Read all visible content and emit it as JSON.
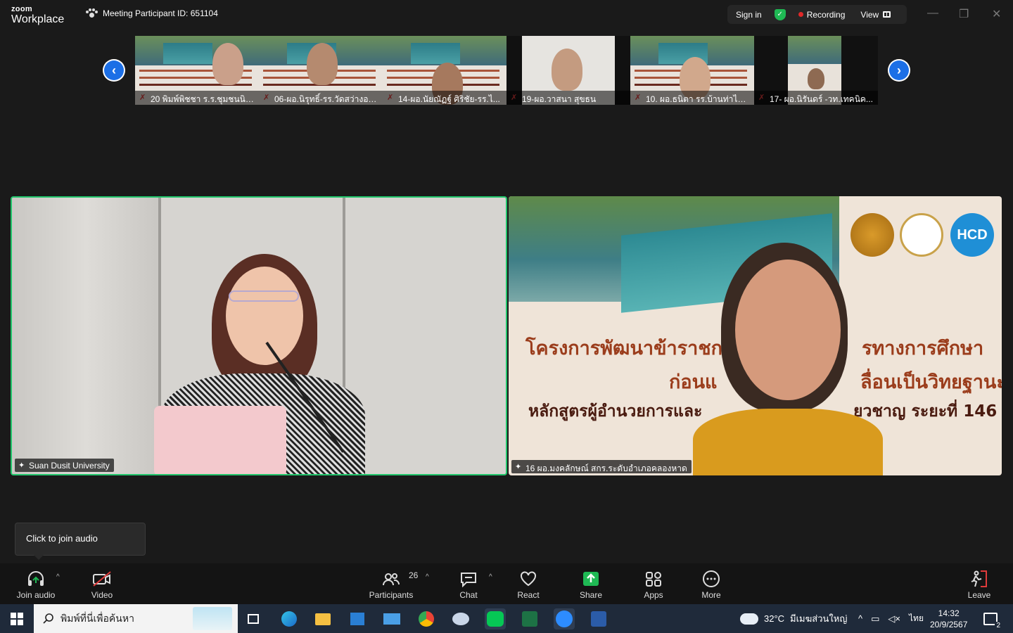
{
  "app": {
    "logo_top": "zoom",
    "logo_bottom": "Workplace"
  },
  "meeting": {
    "id_text": "Meeting Participant ID: 651104"
  },
  "top_bar": {
    "sign_in": "Sign in",
    "recording": "Recording",
    "view": "View"
  },
  "window_controls": {
    "minimize": "—",
    "restore": "❐",
    "close": "✕"
  },
  "thumbnails": [
    {
      "label": "20 พิมพ์พิชชา ร.ร.ชุมชนนิคม...",
      "muted": true
    },
    {
      "label": "06-ผอ.นิรุทธิ์-รร.วัดสว่างอาร...",
      "muted": true
    },
    {
      "label": "14-ผอ.นัยณัฏฐ์ ศิริชัย-รร.ไ...",
      "muted": true
    },
    {
      "label": "19-ผอ.วาสนา สุขธน",
      "muted": true
    },
    {
      "label": "10. ผอ.ธนิตา รร.บ้านท่าไม้ร...",
      "muted": true
    },
    {
      "label": "17- ผอ.นิรันดร์ -วท.เทคนิค...",
      "muted": true
    }
  ],
  "nav": {
    "prev": "‹",
    "next": "›"
  },
  "videos": {
    "left_label": "Suan Dusit University",
    "right_label": "16 ผอ.มงคลักษณ์ สกร.ระดับอำเภอคลองหาด",
    "banner_line1": "โครงการพัฒนาข้าราชก",
    "banner_line1b": "รทางการศึกษา",
    "banner_line2": "ก่อนแ",
    "banner_line2b": "ลื่อนเป็นวิทยฐานะ",
    "banner_line3": "หลักสูตรผู้อำนวยการและ",
    "banner_line3b": "ยวชาญ ระยะที่ 146",
    "logo_hcd": "HCD"
  },
  "tooltip": {
    "text": "Click to join audio"
  },
  "toolbar": {
    "join_audio": "Join audio",
    "video": "Video",
    "participants": "Participants",
    "participants_count": "26",
    "chat": "Chat",
    "react": "React",
    "share": "Share",
    "apps": "Apps",
    "more": "More",
    "leave": "Leave"
  },
  "taskbar": {
    "search_placeholder": "พิมพ์ที่นี่เพื่อค้นหา",
    "weather_temp": "32°C",
    "weather_desc": "มีเมฆส่วนใหญ่",
    "lang": "ไทย",
    "time": "14:32",
    "date": "20/9/2567",
    "notifications": "2"
  },
  "colors": {
    "accent": "#1c6fe6",
    "speaker_border": "#21c56b",
    "recording": "#e02828",
    "share_green": "#1fb954",
    "leave_red": "#e03b3b"
  }
}
